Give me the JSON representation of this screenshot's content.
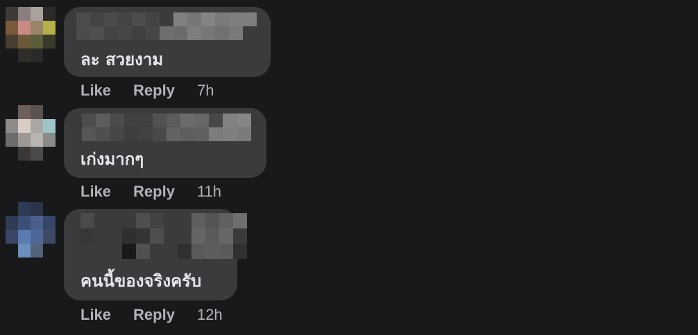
{
  "comments": [
    {
      "text": "ละ สวยงาม",
      "like_label": "Like",
      "reply_label": "Reply",
      "time": "7h"
    },
    {
      "text": "เก่งมากๆ",
      "like_label": "Like",
      "reply_label": "Reply",
      "time": "11h"
    },
    {
      "text": "คนนี้ของจริงครับ",
      "like_label": "Like",
      "reply_label": "Reply",
      "time": "12h"
    }
  ],
  "colors": {
    "background": "#18191a",
    "bubble": "#3a3b3c",
    "text": "#e4e6eb",
    "secondary_text": "#b0b3b8"
  }
}
